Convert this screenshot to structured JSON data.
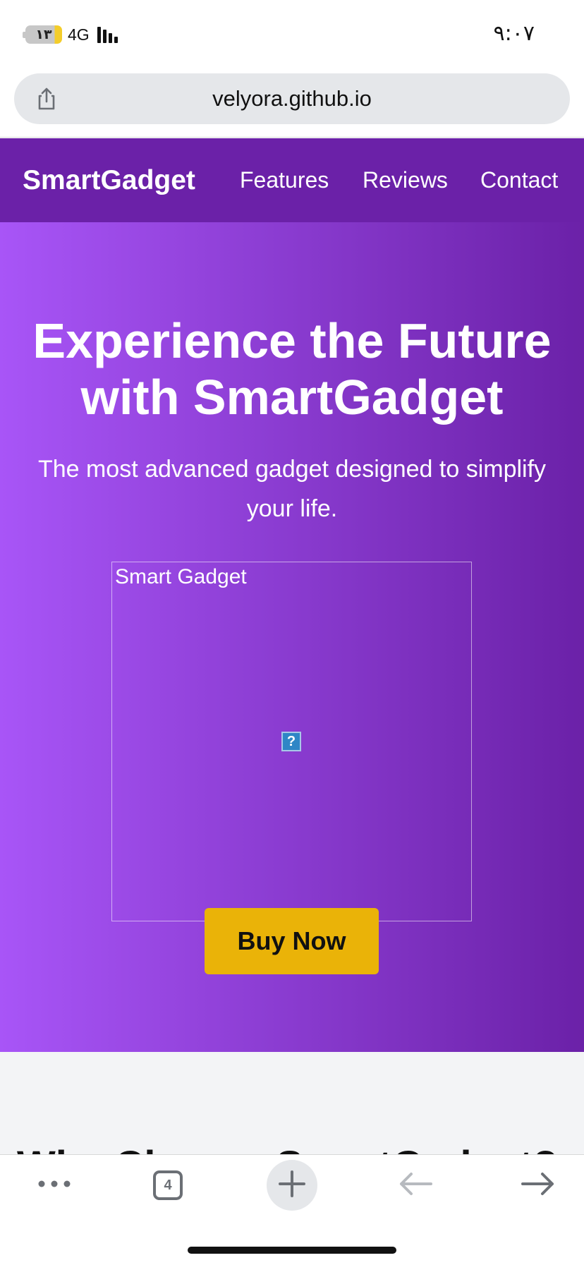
{
  "status_bar": {
    "battery_level": "١٣",
    "network": "4G",
    "time": "٩:٠٧"
  },
  "browser": {
    "url": "velyora.github.io",
    "tab_count": "4"
  },
  "site": {
    "brand": "SmartGadget",
    "nav": {
      "features": "Features",
      "reviews": "Reviews",
      "contact": "Contact"
    },
    "hero": {
      "title": "Experience the Future with SmartGadget",
      "subtitle": "The most advanced gadget designed to simplify your life.",
      "image_alt": "Smart Gadget",
      "cta": "Buy Now"
    },
    "next_section_heading": "Why Choose SmartGadget?"
  },
  "colors": {
    "nav_bg": "#6b21a8",
    "hero_gradient_start": "#a855f7",
    "hero_gradient_end": "#6b21a8",
    "cta_bg": "#eab308"
  },
  "icons": {
    "share": "share-icon",
    "more": "more-icon",
    "tabs": "tabs-icon",
    "new_tab": "plus-icon",
    "back": "back-arrow-icon",
    "forward": "forward-arrow-icon"
  }
}
